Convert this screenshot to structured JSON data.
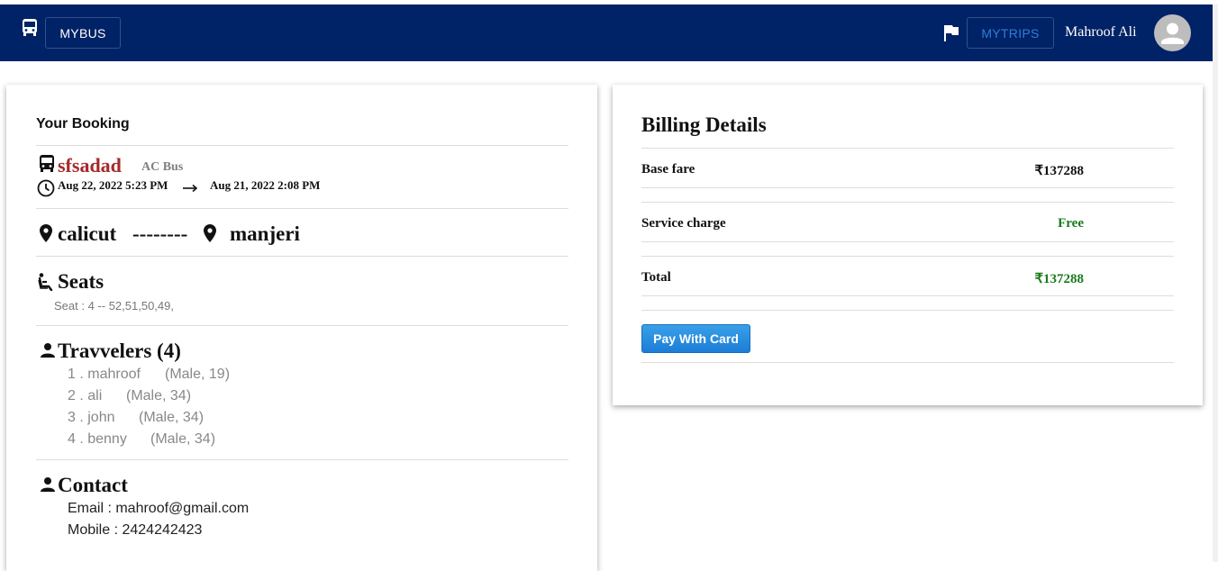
{
  "navbar": {
    "brand_label": "MYBUS",
    "mytrips_label": "MYTRIPS",
    "user_name": "Mahroof Ali",
    "bg_color": "#002266"
  },
  "booking": {
    "title": "Your Booking",
    "bus_name": "sfsadad",
    "bus_type": "AC Bus",
    "departure": "Aug 22, 2022 5:23 PM",
    "arrival": "Aug 21, 2022 2:08 PM",
    "from": "calicut",
    "separator": "--------",
    "to": "manjeri",
    "seats_heading": "Seats",
    "seats_info": "Seat : 4 -- 52,51,50,49,",
    "travelers_heading": "Travvelers (4)",
    "travelers": [
      {
        "index": "1 . mahroof",
        "details": "(Male, 19)"
      },
      {
        "index": "2 . ali",
        "details": "(Male, 34)"
      },
      {
        "index": "3 . john",
        "details": "(Male, 34)"
      },
      {
        "index": "4 . benny",
        "details": "(Male, 34)"
      }
    ],
    "contact_heading": "Contact",
    "email_line": "Email : mahroof@gmail.com",
    "mobile_line": "Mobile : 2424242423"
  },
  "billing": {
    "title": "Billing Details",
    "base_fare_label": "Base fare",
    "base_fare_value": "₹137288",
    "service_label": "Service charge",
    "service_value": "Free",
    "total_label": "Total",
    "total_value": "₹137288",
    "pay_button": "Pay With Card",
    "accent_green": "#1a7a1a"
  }
}
